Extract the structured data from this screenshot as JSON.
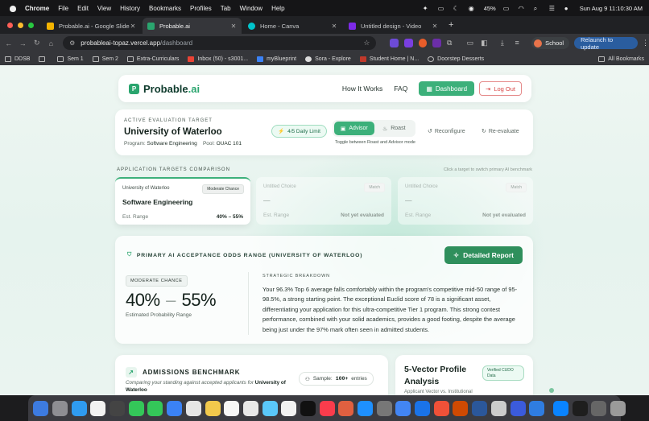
{
  "menubar": {
    "app": "Chrome",
    "items": [
      "File",
      "Edit",
      "View",
      "History",
      "Bookmarks",
      "Profiles",
      "Tab",
      "Window",
      "Help"
    ],
    "battery": "45%",
    "clock": "Sun Aug 9  11:10:30 AM"
  },
  "tabs": [
    {
      "title": "Probable.ai - Google Slides",
      "color": "#f4b400",
      "active": false
    },
    {
      "title": "Probable.ai",
      "color": "#2aa56e",
      "active": true
    },
    {
      "title": "Home - Canva",
      "color": "#00c4cc",
      "active": false
    },
    {
      "title": "Untitled design - Video",
      "color": "#7d2ae8",
      "active": false
    }
  ],
  "address": {
    "host": "probableai-topaz.vercel.app",
    "path": "/dashboard"
  },
  "browser": {
    "profile": "School",
    "relaunch": "Relaunch to update"
  },
  "bookmarks": [
    "DDSB",
    "Sem 1",
    "Sem 2",
    "Extra-Curriculars",
    "Inbox (50) - s3001...",
    "myBlueprint",
    "Sora - Explore",
    "Student Home | N...",
    "Doorstep Desserts"
  ],
  "bookmarks_all": "All Bookmarks",
  "nav": {
    "logo_main": "Probable",
    "logo_suffix": ".ai",
    "link_how": "How It Works",
    "link_faq": "FAQ",
    "dashboard": "Dashboard",
    "logout": "Log Out"
  },
  "eval": {
    "eyebrow": "ACTIVE EVALUATION TARGET",
    "university": "University of Waterloo",
    "program_label": "Program:",
    "program": "Software Engineering",
    "pool_label": "Pool:",
    "pool": "OUAC 101",
    "limit": "4/5 Daily Limit",
    "advisor": "Advisor",
    "roast": "Roast",
    "toggle_hint": "Toggle between Roast and Advisor mode",
    "reconfigure": "Reconfigure",
    "reevaluate": "Re-evaluate"
  },
  "comparison": {
    "title": "APPLICATION TARGETS COMPARISON",
    "hint": "Click a target to switch primary AI benchmark",
    "cards": [
      {
        "uni": "University of Waterloo",
        "badge": "Moderate Chance",
        "program": "Software Engineering",
        "range_label": "Est. Range",
        "range": "40% – 55%"
      },
      {
        "uni": "Untitled Choice",
        "badge": "Match",
        "program": "—",
        "range_label": "Est. Range",
        "range": "Not yet evaluated"
      },
      {
        "uni": "Untitled Choice",
        "badge": "Match",
        "program": "—",
        "range_label": "Est. Range",
        "range": "Not yet evaluated"
      }
    ]
  },
  "odds": {
    "title": "PRIMARY AI ACCEPTANCE ODDS RANGE (UNIVERSITY OF WATERLOO)",
    "report_button": "Detailed Report",
    "badge": "MODERATE CHANCE",
    "low": "40%",
    "high": "55%",
    "estimate_label": "Estimated Probability Range",
    "breakdown_title": "STRATEGIC BREAKDOWN",
    "breakdown": "Your 96.3% Top 6 average falls comfortably within the program's competitive mid-50 range of 95-98.5%, a strong starting point. The exceptional Euclid score of 78 is a significant asset, differentiating your application for this ultra-competitive Tier 1 program. This strong contest performance, combined with your solid academics, provides a good footing, despite the average being just under the 97% mark often seen in admitted students."
  },
  "benchmark": {
    "title": "ADMISSIONS BENCHMARK",
    "subtitle_pre": "Comparing your standing against accepted applicants for",
    "subtitle_uni": "University of Waterloo",
    "sample_label": "Sample:",
    "sample_n": "100+",
    "sample_suffix": "entries"
  },
  "vector": {
    "title": "5-Vector Profile Analysis",
    "badge": "Verified CUDO Data",
    "subtitle": "Applicant Vector vs. Institutional"
  },
  "dock_colors": [
    "#3d7be0",
    "#8e8e93",
    "#2f9bf0",
    "#f2f2f2",
    "#444",
    "#34c759",
    "#34c759",
    "#3b82f6",
    "#e5e5e5",
    "#f2c94c",
    "#f7f7f7",
    "#e8e8e8",
    "#5ac8fa",
    "#f2f2f2",
    "#111",
    "#fa3c4c",
    "#e06040",
    "#1e90ff",
    "#777",
    "#4285f4",
    "#1a73e8",
    "#f05138",
    "#d04a02",
    "#2b579a",
    "#ccc",
    "#3b5bdb",
    "#2f7de1",
    "#0a84ff",
    "#1e1e1e",
    "#666",
    "#9a9a9a"
  ]
}
